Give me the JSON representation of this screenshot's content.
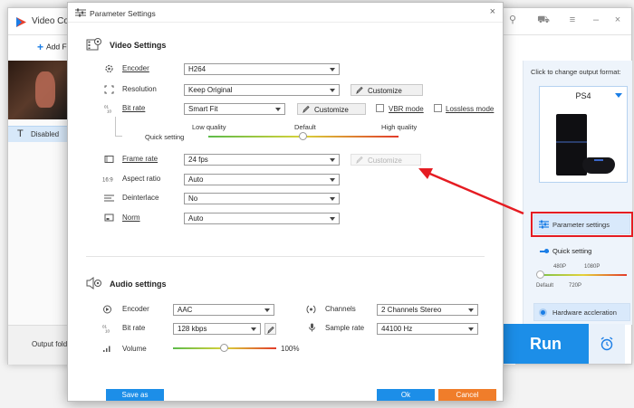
{
  "main_window": {
    "title": "Video Con",
    "add_files": "Add Fi",
    "subtitle_status": "Disabled",
    "output_folder_label": "Output folder",
    "change_format_label": "Click to change output format:",
    "format_name": "PS4",
    "param_settings_btn": "Parameter settings",
    "quick_setting_label": "Quick setting",
    "ticks_top": [
      "480P",
      "1080P"
    ],
    "ticks_bottom": [
      "Default",
      "720P"
    ],
    "hw_accel_btn": "Hardware accleration",
    "run_btn": "Run"
  },
  "dialog": {
    "title": "Parameter Settings",
    "close_glyph": "×",
    "video": {
      "section_title": "Video Settings",
      "encoder": {
        "label": "Encoder",
        "value": "H264"
      },
      "resolution": {
        "label": "Resolution",
        "value": "Keep Original",
        "customize": "Customize"
      },
      "bitrate": {
        "label": "Bit rate",
        "value": "Smart Fit",
        "customize": "Customize",
        "vbr": "VBR mode",
        "lossless": "Lossless mode"
      },
      "quality": {
        "low": "Low quality",
        "default": "Default",
        "high": "High quality",
        "quick_setting": "Quick setting",
        "level": 0.5
      },
      "framerate": {
        "label": "Frame rate",
        "value": "24 fps",
        "customize": "Customize"
      },
      "aspect": {
        "label": "Aspect ratio",
        "value": "Auto"
      },
      "deinterlace": {
        "label": "Deinterlace",
        "value": "No"
      },
      "norm": {
        "label": "Norm",
        "value": "Auto"
      }
    },
    "audio": {
      "section_title": "Audio settings",
      "encoder": {
        "label": "Encoder",
        "value": "AAC"
      },
      "channels": {
        "label": "Channels",
        "value": "2 Channels Stereo"
      },
      "bitrate": {
        "label": "Bit rate",
        "value": "128 kbps"
      },
      "samplerate": {
        "label": "Sample rate",
        "value": "44100 Hz"
      },
      "volume": {
        "label": "Volume",
        "value": "100%",
        "level": 0.5
      }
    },
    "footer": {
      "save_as": "Save as",
      "ok": "Ok",
      "cancel": "Cancel"
    }
  },
  "colors": {
    "accent": "#1c8ee8",
    "annotation": "#e51c22",
    "cancel": "#f07d2a"
  }
}
